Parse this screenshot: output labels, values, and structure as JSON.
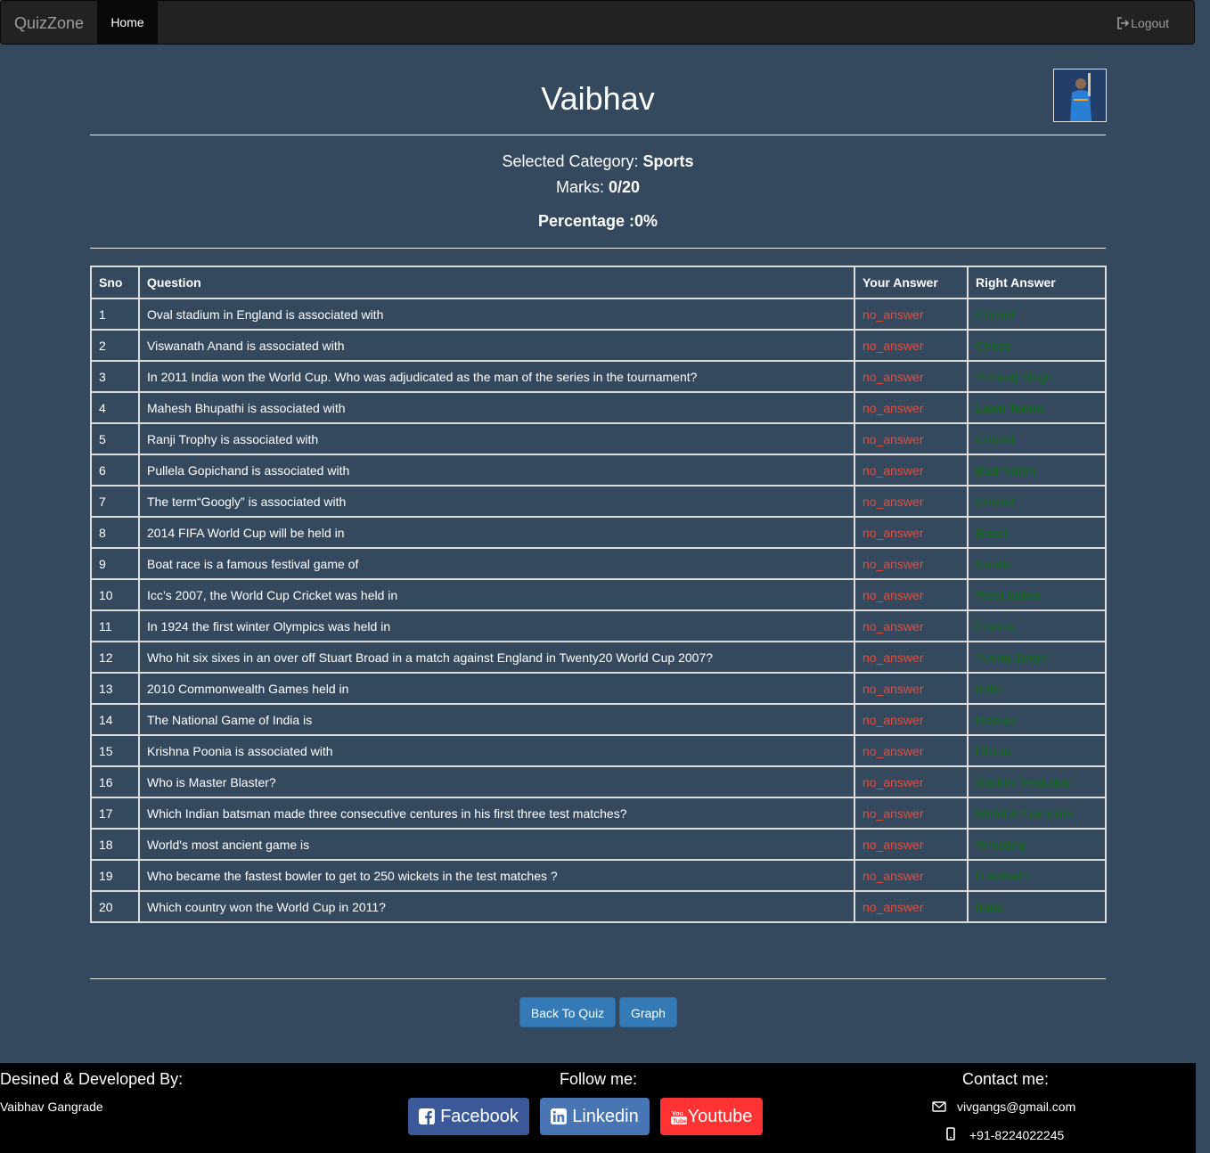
{
  "navbar": {
    "brand": "QuizZone",
    "home": "Home",
    "logout": "Logout"
  },
  "header": {
    "name": "Vaibhav",
    "avatar_alt": "profile picture"
  },
  "summary": {
    "category_label": "Selected Category:",
    "category": "Sports",
    "marks_label": "Marks:",
    "marks": "0/20",
    "percentage": "Percentage :0%"
  },
  "table": {
    "headers": [
      "Sno",
      "Question",
      "Your Answer",
      "Right Answer"
    ],
    "rows": [
      {
        "sno": "1",
        "question": "Oval stadium in England is associated with",
        "answer": "no_answer",
        "right": "Cricket"
      },
      {
        "sno": "2",
        "question": "Viswanath Anand is associated with",
        "answer": "no_answer",
        "right": "Chess"
      },
      {
        "sno": "3",
        "question": "In 2011 India won the World Cup. Who was adjudicated as the man of the series in the tournament?",
        "answer": "no_answer",
        "right": "Yuvaraj Singh"
      },
      {
        "sno": "4",
        "question": "Mahesh Bhupathi is associated with",
        "answer": "no_answer",
        "right": "Lawn Tennis"
      },
      {
        "sno": "5",
        "question": "Ranji Trophy is associated with",
        "answer": "no_answer",
        "right": "Cricket"
      },
      {
        "sno": "6",
        "question": "Pullela Gopichand is associated with",
        "answer": "no_answer",
        "right": "Badminton"
      },
      {
        "sno": "7",
        "question": "The term“Googly” is associated with",
        "answer": "no_answer",
        "right": "Cricket"
      },
      {
        "sno": "8",
        "question": "2014 FIFA World Cup will be held in",
        "answer": "no_answer",
        "right": "Brazil"
      },
      {
        "sno": "9",
        "question": "Boat race is a famous festival game of",
        "answer": "no_answer",
        "right": "Kerala"
      },
      {
        "sno": "10",
        "question": "Icc’s 2007, the World Cup Cricket was held in",
        "answer": "no_answer",
        "right": "West Indies"
      },
      {
        "sno": "11",
        "question": "In 1924 the first winter Olympics was held in",
        "answer": "no_answer",
        "right": "France"
      },
      {
        "sno": "12",
        "question": "Who hit six sixes in an over off Stuart Broad in a match against England in Twenty20 World Cup 2007?",
        "answer": "no_answer",
        "right": "Yuvraj Singh"
      },
      {
        "sno": "13",
        "question": "2010 Commonwealth Games held in",
        "answer": "no_answer",
        "right": "India"
      },
      {
        "sno": "14",
        "question": "The National Game of India is",
        "answer": "no_answer",
        "right": "Hockey"
      },
      {
        "sno": "15",
        "question": "Krishna Poonia is associated with",
        "answer": "no_answer",
        "right": "Discus"
      },
      {
        "sno": "16",
        "question": "Who is Master Blaster?",
        "answer": "no_answer",
        "right": "Sachin Tendulkar"
      },
      {
        "sno": "17",
        "question": "Which Indian batsman made three consecutive centures in his first three test matches?",
        "answer": "no_answer",
        "right": "Mohd Azharuddin"
      },
      {
        "sno": "18",
        "question": "World's most ancient game is",
        "answer": "no_answer",
        "right": "Wrestling"
      },
      {
        "sno": "19",
        "question": "Who became the fastest bowler to get to 250 wickets in the test matches ?",
        "answer": "no_answer",
        "right": "R Ashwin"
      },
      {
        "sno": "20",
        "question": "Which country won the World Cup in 2011?",
        "answer": "no_answer",
        "right": "India"
      }
    ]
  },
  "buttons": {
    "back": "Back To Quiz",
    "graph": "Graph"
  },
  "footer": {
    "designed_title": "Desined & Developed By:",
    "developer": "Vaibhav Gangrade",
    "follow_title": "Follow me:",
    "facebook": "Facebook",
    "linkedin": "Linkedin",
    "youtube": "Youtube",
    "contact_title": "Contact me:",
    "email": "vivgangs@gmail.com",
    "phone": "+91-8224022245"
  },
  "colors": {
    "page_bg": "#34495e",
    "no_answer": "#e74c3c",
    "right_answer": "#0f6e12",
    "facebook": "#3b5998",
    "linkedin": "#4875b4",
    "youtube": "#f33"
  }
}
